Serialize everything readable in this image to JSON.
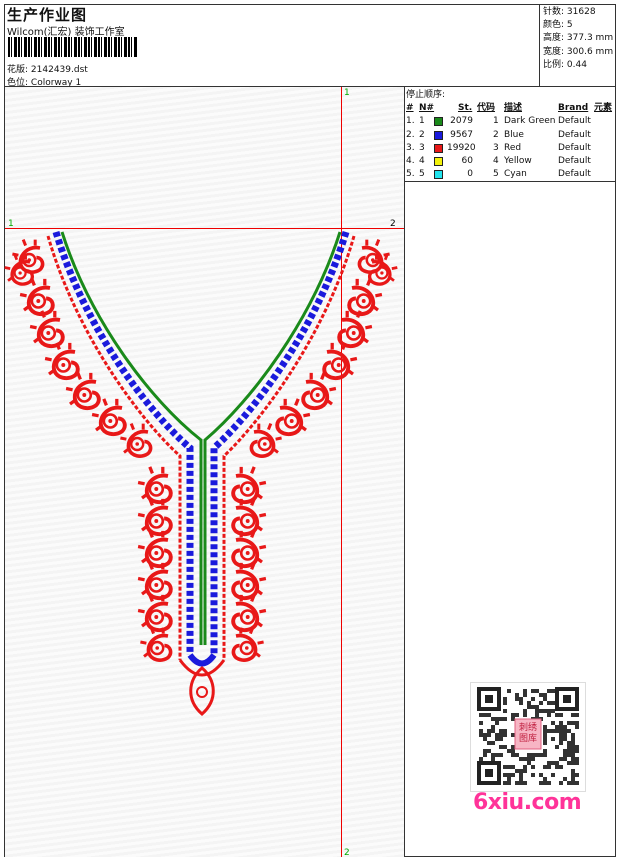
{
  "header": {
    "title": "生产作业图",
    "company": "Wilcom(汇宏) 装饰工作室",
    "design_label": "花版:",
    "design_value": "2142439.dst",
    "colorway_label": "色位:",
    "colorway_value": "Colorway 1"
  },
  "stats": {
    "stitches_label": "针数:",
    "stitches_value": "31628",
    "colors_label": "颜色:",
    "colors_value": "5",
    "height_label": "高度:",
    "height_value": "377.3 mm",
    "width_label": "宽度:",
    "width_value": "300.6 mm",
    "scale_label": "比例:",
    "scale_value": "0.44"
  },
  "guides": {
    "top_v": "1",
    "bottom_v": "2",
    "left_h": "1",
    "right_h": "2"
  },
  "stop_sequence": {
    "caption": "停止顺序:",
    "columns": {
      "num": "#",
      "n": "N#",
      "st": "St.",
      "code": "代码",
      "desc": "描述",
      "brand": "Brand",
      "element": "元素"
    },
    "rows": [
      {
        "num": "1.",
        "n": "1",
        "color": "#1a8a1a",
        "st": "2079",
        "code": "1",
        "desc": "Dark Green",
        "brand": "Default"
      },
      {
        "num": "2.",
        "n": "2",
        "color": "#1a1adc",
        "st": "9567",
        "code": "2",
        "desc": "Blue",
        "brand": "Default"
      },
      {
        "num": "3.",
        "n": "3",
        "color": "#e81818",
        "st": "19920",
        "code": "3",
        "desc": "Red",
        "brand": "Default"
      },
      {
        "num": "4.",
        "n": "4",
        "color": "#f2f20a",
        "st": "60",
        "code": "4",
        "desc": "Yellow",
        "brand": "Default"
      },
      {
        "num": "5.",
        "n": "5",
        "color": "#22e4ee",
        "st": "0",
        "code": "5",
        "desc": "Cyan",
        "brand": "Default"
      }
    ]
  },
  "colors": {
    "red": "#e81818",
    "blue": "#1a1adc",
    "green": "#1a8a1a",
    "guide": "#ee0000"
  },
  "watermark": {
    "qr_caption": "6xiu.com",
    "qr_stamp": "刺绣图库"
  }
}
